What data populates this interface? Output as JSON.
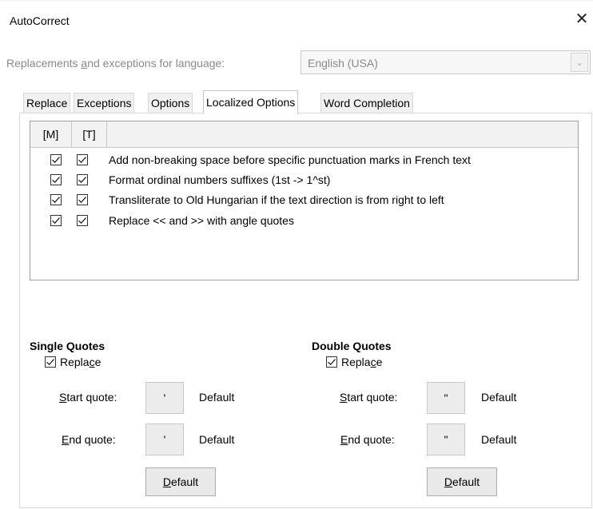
{
  "window": {
    "title": "AutoCorrect",
    "close_label": "✕"
  },
  "language": {
    "label_pre": "Replacements ",
    "label_mnemonic": "a",
    "label_post": "nd exceptions for language:",
    "selected": "English (USA)"
  },
  "tabs": [
    {
      "label": "Replace",
      "active": false
    },
    {
      "label": "Exceptions",
      "active": false
    },
    {
      "label": "Options",
      "active": false
    },
    {
      "label": "Localized Options",
      "active": true
    },
    {
      "label": "Word Completion",
      "active": false
    }
  ],
  "options_list": {
    "headers": [
      "[M]",
      "[T]",
      ""
    ],
    "rows": [
      {
        "m": true,
        "t": true,
        "label": "Add non-breaking space before specific punctuation marks in French text"
      },
      {
        "m": true,
        "t": true,
        "label": "Format ordinal numbers suffixes (1st -> 1^st)"
      },
      {
        "m": true,
        "t": true,
        "label": "Transliterate to Old Hungarian if the text direction is from right to left"
      },
      {
        "m": true,
        "t": true,
        "label": "Replace << and >> with angle quotes"
      }
    ]
  },
  "single_quotes": {
    "title": "Single Quotes",
    "replace_pre": "Repla",
    "replace_mnemonic": "c",
    "replace_post": "e",
    "replace_checked": true,
    "start_mnemonic": "S",
    "start_post": "tart quote:",
    "start_char": "'",
    "start_default": "Default",
    "end_mnemonic": "E",
    "end_post": "nd quote:",
    "end_char": "'",
    "end_default": "Default",
    "default_btn_mnemonic": "D",
    "default_btn_post": "efault"
  },
  "double_quotes": {
    "title": "Double Quotes",
    "replace_pre": "Repla",
    "replace_mnemonic": "c",
    "replace_post": "e",
    "replace_checked": true,
    "start_mnemonic": "S",
    "start_post": "tart quote:",
    "start_char": "\"",
    "start_default": "Default",
    "end_mnemonic": "E",
    "end_post": "nd quote:",
    "end_char": "\"",
    "end_default": "Default",
    "default_btn_pre": "",
    "default_btn_mnemonic": "D",
    "default_btn_post": "efault"
  },
  "icons": {
    "close": "close-icon",
    "dropdown": "chevron-down-icon",
    "check": "checkmark-icon"
  }
}
